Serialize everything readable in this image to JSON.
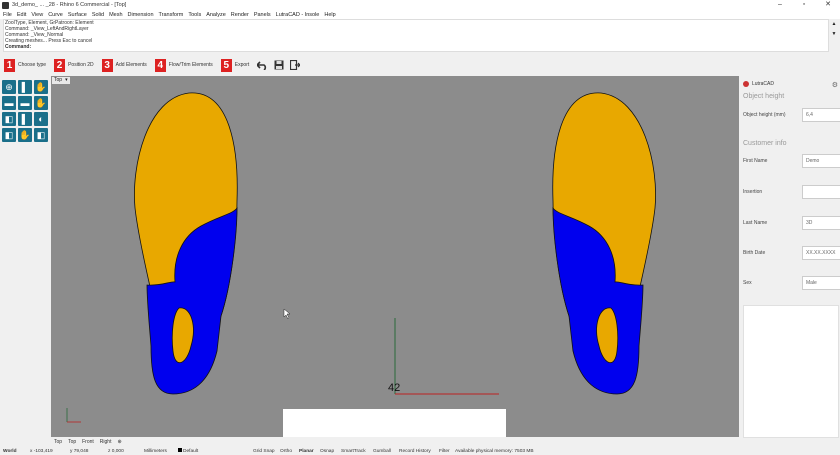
{
  "window": {
    "title": "3d_demo_ ... _28 - Rhino 6 Commercial - [Top]",
    "controls": [
      "–",
      "▫",
      "✕"
    ]
  },
  "menu": [
    "File",
    "Edit",
    "View",
    "Curve",
    "Surface",
    "Solid",
    "Mesh",
    "Dimension",
    "Transform",
    "Tools",
    "Analyze",
    "Render",
    "Panels",
    "LutraCAD - Insole",
    "Help"
  ],
  "command_history": [
    "ZoolType, Element, GrPatroon: Element",
    "Command: _View_LeftAndRightLayer",
    "Command: _View_Normal",
    "Creating meshes... Press Esc to cancel"
  ],
  "command_prompt": "Command:",
  "toolbar": {
    "steps": [
      {
        "num": "1",
        "label": "Choose type"
      },
      {
        "num": "2",
        "label": "Position 2D"
      },
      {
        "num": "3",
        "label": "Add Elements"
      },
      {
        "num": "4",
        "label": "Flow/Trim Elements"
      },
      {
        "num": "5",
        "label": "Export"
      }
    ]
  },
  "left_tools": [
    "⊕",
    "▌",
    "✋",
    "▬",
    "▬",
    "✋",
    "◧",
    "▌",
    "◐",
    "◧",
    "✋",
    "◧"
  ],
  "viewport": {
    "name": "Top",
    "dropdown": "▾",
    "axis_number": "42"
  },
  "right_panel": {
    "brand": "LutraCAD",
    "object_section": "Object height",
    "object_height_label": "Object height (mm)",
    "object_height_value": "6,4",
    "customer_section": "Customer info",
    "first_name_label": "First Name",
    "first_name_value": "Demo",
    "insertion_label": "Insertion",
    "insertion_value": "",
    "last_name_label": "Last Name",
    "last_name_value": "3D",
    "birth_date_label": "Birth Date",
    "birth_date_value": "XX.XX.XXXX",
    "sex_label": "Sex",
    "sex_value": "Male"
  },
  "viewport_tabs": [
    "Top",
    "Top",
    "Front",
    "Right",
    "⊕"
  ],
  "status": {
    "cplane": "World",
    "x": "x -103,419",
    "y": "y 79,048",
    "z": "z 0,000",
    "units": "Millimeters",
    "layer": "Default",
    "toggles": [
      "Grid Snap",
      "Ortho",
      "Planar",
      "Osnap",
      "SmartTrack",
      "Gumball",
      "Record History",
      "Filter"
    ],
    "memory": "Available physical memory: 7503 MB"
  },
  "colors": {
    "insole_top": "#e8a800",
    "insole_bottom": "#0000ee",
    "viewport_bg": "#8c8c8c",
    "step_badge": "#dd2222"
  }
}
